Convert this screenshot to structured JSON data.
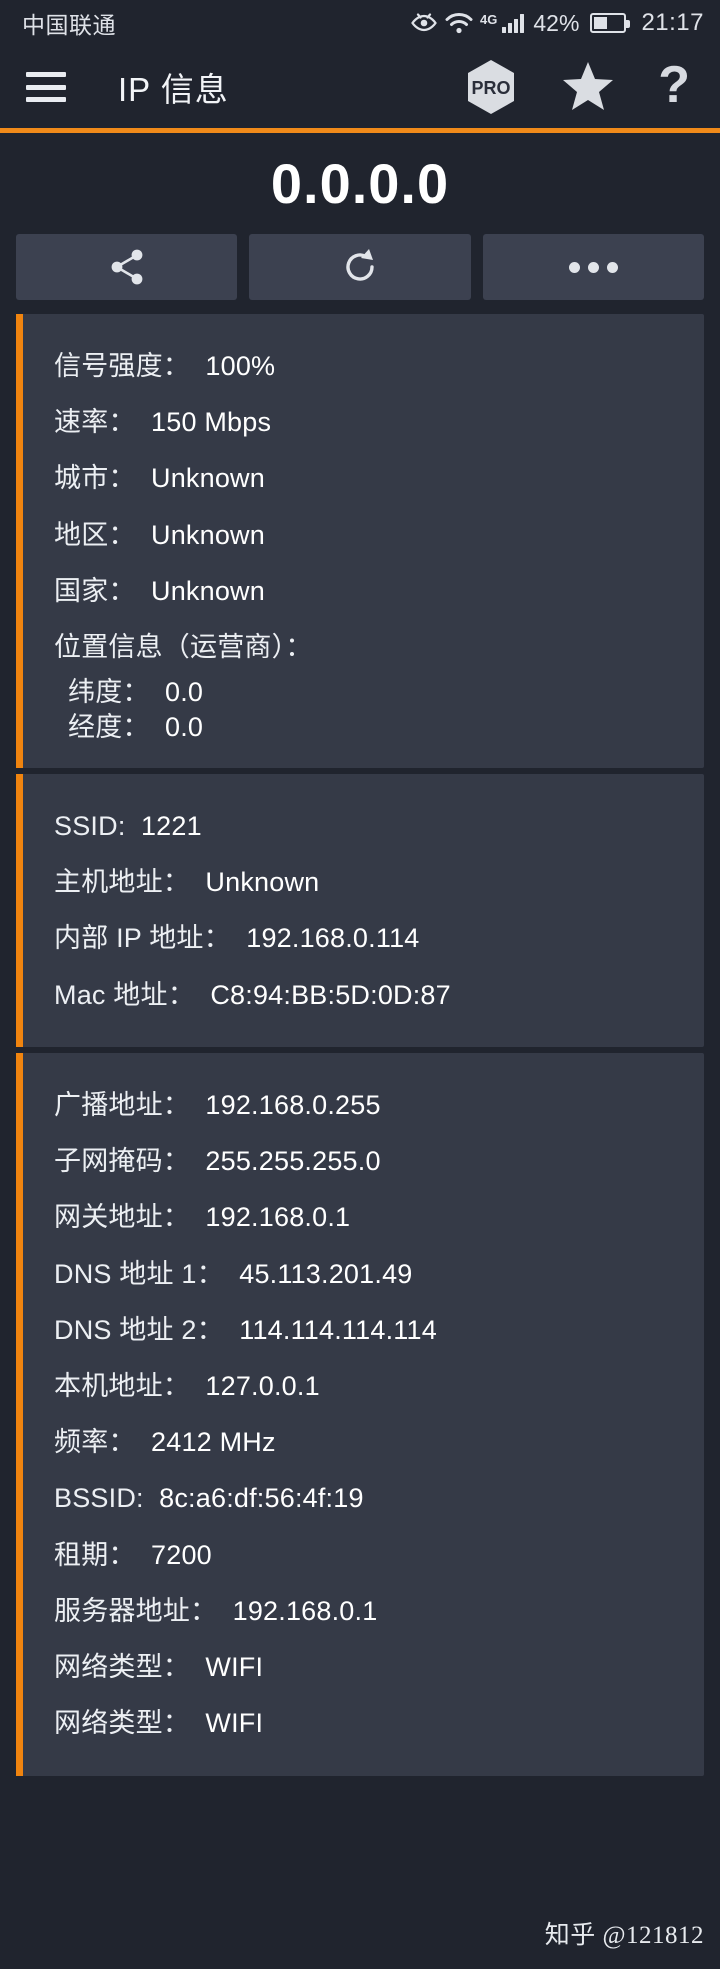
{
  "status_bar": {
    "carrier": "中国联通",
    "network_type": "4G",
    "battery_percent": "42%",
    "clock": "21:17",
    "icons": [
      "eye-icon",
      "wifi-icon",
      "signal-bars-icon",
      "battery-icon"
    ]
  },
  "app_bar": {
    "menu_icon": "hamburger-menu-icon",
    "title": "IP 信息",
    "pro_label": "PRO",
    "star_icon": "star-icon",
    "help_label": "?"
  },
  "hero": {
    "ip_address": "0.0.0.0"
  },
  "actions": [
    {
      "name": "share-button",
      "icon": "share-icon"
    },
    {
      "name": "refresh-button",
      "icon": "refresh-icon"
    },
    {
      "name": "more-button",
      "icon": "more-dots-icon"
    }
  ],
  "cards": [
    {
      "name": "connection-info-card",
      "rows": [
        {
          "label": "信号强度：",
          "value": "100%"
        },
        {
          "label": "速率：",
          "value": "150 Mbps"
        },
        {
          "label": "城市：",
          "value": "Unknown"
        },
        {
          "label": "地区：",
          "value": "Unknown"
        },
        {
          "label": "国家：",
          "value": "Unknown"
        },
        {
          "label": "位置信息（运营商）：",
          "value": ""
        },
        {
          "label": "纬度：",
          "value": "0.0",
          "indent": true,
          "compact": true
        },
        {
          "label": "经度：",
          "value": "0.0",
          "indent": true,
          "compact": true
        }
      ]
    },
    {
      "name": "wifi-identity-card",
      "rows": [
        {
          "label": "SSID:",
          "value": "1221"
        },
        {
          "label": "主机地址：",
          "value": "Unknown"
        },
        {
          "label": "内部 IP 地址：",
          "value": "192.168.0.114"
        },
        {
          "label": "Mac 地址：",
          "value": "C8:94:BB:5D:0D:87"
        }
      ]
    },
    {
      "name": "network-details-card",
      "rows": [
        {
          "label": "广播地址：",
          "value": "192.168.0.255"
        },
        {
          "label": "子网掩码：",
          "value": "255.255.255.0"
        },
        {
          "label": "网关地址：",
          "value": "192.168.0.1"
        },
        {
          "label": "DNS 地址 1：",
          "value": "45.113.201.49"
        },
        {
          "label": "DNS 地址 2：",
          "value": "114.114.114.114"
        },
        {
          "label": "本机地址：",
          "value": "127.0.0.1"
        },
        {
          "label": "频率：",
          "value": "2412 MHz"
        },
        {
          "label": "BSSID:",
          "value": "8c:a6:df:56:4f:19"
        },
        {
          "label": "租期：",
          "value": "7200"
        },
        {
          "label": "服务器地址：",
          "value": "192.168.0.1"
        },
        {
          "label": "网络类型：",
          "value": "WIFI"
        },
        {
          "label": "网络类型：",
          "value": "WIFI"
        }
      ]
    }
  ],
  "watermark": "知乎 @121812",
  "colors": {
    "background": "#20242e",
    "card_background": "#353a47",
    "accent_orange": "#f0840f",
    "button_background": "#3c4150",
    "text_primary": "#eceff3"
  }
}
